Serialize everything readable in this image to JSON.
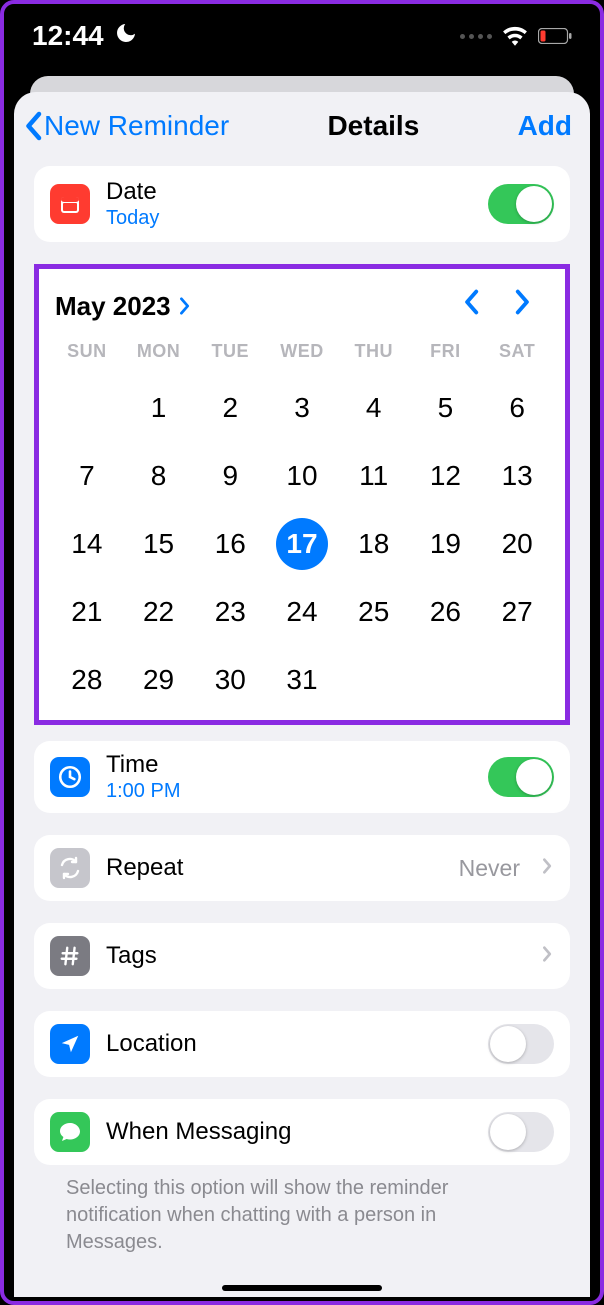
{
  "status": {
    "time": "12:44",
    "moon": "🌙"
  },
  "nav": {
    "back": "New Reminder",
    "title": "Details",
    "action": "Add"
  },
  "date": {
    "label": "Date",
    "value": "Today",
    "on": true
  },
  "calendar": {
    "title": "May 2023",
    "weekdays": [
      "SUN",
      "MON",
      "TUE",
      "WED",
      "THU",
      "FRI",
      "SAT"
    ],
    "firstWeekdayIndex": 1,
    "daysInMonth": 31,
    "selectedDay": 17
  },
  "time": {
    "label": "Time",
    "value": "1:00 PM",
    "on": true
  },
  "repeat": {
    "label": "Repeat",
    "value": "Never"
  },
  "tags": {
    "label": "Tags"
  },
  "location": {
    "label": "Location",
    "on": false
  },
  "messaging": {
    "label": "When Messaging",
    "on": false,
    "footer": "Selecting this option will show the reminder notification when chatting with a person in Messages."
  }
}
